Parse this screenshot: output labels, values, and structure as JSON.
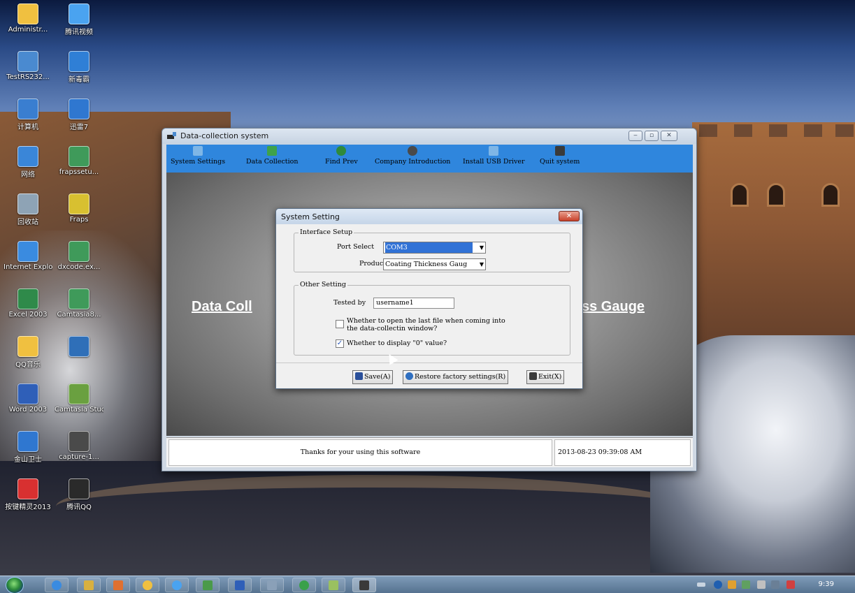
{
  "desktop": {
    "icons": [
      {
        "label": "Administr...",
        "color": "#f0c040"
      },
      {
        "label": "腾讯视频",
        "color": "#4aa3f0"
      },
      {
        "label": "TestRS232...",
        "color": "#4a8ad0"
      },
      {
        "label": "新毒霸",
        "color": "#2f7fd6"
      },
      {
        "label": "计算机",
        "color": "#3a7ed0"
      },
      {
        "label": "迅雷7",
        "color": "#2f77d0"
      },
      {
        "label": "网络",
        "color": "#3a86d8"
      },
      {
        "label": "frapssetu...",
        "color": "#3f9a5a"
      },
      {
        "label": "回收站",
        "color": "#8ea3b5"
      },
      {
        "label": "Fraps",
        "color": "#d8c030"
      },
      {
        "label": "Internet Explorer",
        "color": "#3a8be0"
      },
      {
        "label": "dxcode.ex...",
        "color": "#3f9a5a"
      },
      {
        "label": "Excel 2003",
        "color": "#2f8a4a"
      },
      {
        "label": "Camtasia8...",
        "color": "#3f9a5a"
      },
      {
        "label": "QQ音乐",
        "color": "#f0c040"
      },
      {
        "label": "",
        "color": "#2f6fb8"
      },
      {
        "label": "Word 2003",
        "color": "#2f5fb8"
      },
      {
        "label": "Camtasia Studio",
        "color": "#6aa040"
      },
      {
        "label": "金山卫士",
        "color": "#2f77d0"
      },
      {
        "label": "capture-1...",
        "color": "#4a4a4a"
      },
      {
        "label": "按键精灵2013",
        "color": "#d83030"
      },
      {
        "label": "腾讯QQ",
        "color": "#2a2a2a"
      }
    ]
  },
  "main_window": {
    "title": "Data-collection system",
    "toolbar": [
      {
        "label": "System Settings",
        "color": "#7fb6e6"
      },
      {
        "label": "Data Collection",
        "color": "#3fa24a"
      },
      {
        "label": "Find Prev",
        "color": "#2f8a3a"
      },
      {
        "label": "Company Introduction",
        "color": "#4a4a4a"
      },
      {
        "label": "Install USB Driver",
        "color": "#7fb6e6"
      },
      {
        "label": "Quit system",
        "color": "#3a3a3a"
      }
    ],
    "banner_left": "Data Coll",
    "banner_right": "ss Gauge",
    "status_message": "Thanks for your using this software",
    "status_time": "2013-08-23 09:39:08 AM"
  },
  "dialog": {
    "title": "System Setting",
    "interface_group": {
      "title": "Interface Setup",
      "port_label": "Port Select",
      "port_value": "COM3",
      "product_label": "Product",
      "product_value": "Coating Thickness Gaug"
    },
    "other_group": {
      "title": "Other Setting",
      "tested_label": "Tested by",
      "tested_value": "username1",
      "open_last_line1": "Whether to open the last file when coming into",
      "open_last_line2": "the data-collectin window?",
      "open_last_checked": false,
      "display_zero_label": "Whether to display \"0\" value?",
      "display_zero_checked": true
    },
    "buttons": {
      "save": "Save(A)",
      "restore": "Restore factory settings(R)",
      "exit": "Exit(X)"
    }
  },
  "taskbar": {
    "clock": "9:39"
  }
}
